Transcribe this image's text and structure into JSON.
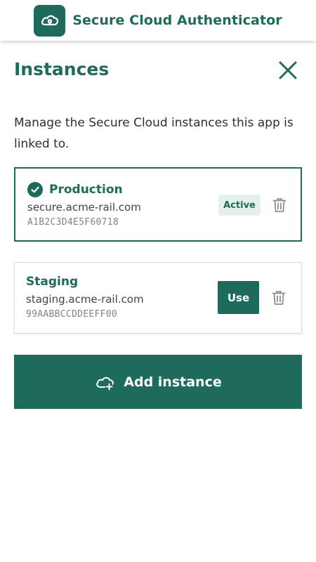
{
  "app": {
    "title": "Secure Cloud Authenticator",
    "logo_icon": "cloud-shield-icon"
  },
  "page": {
    "title": "Instances",
    "close_icon": "close-icon",
    "description": "Manage the Secure Cloud instances this app is linked to."
  },
  "instances": [
    {
      "name": "Production",
      "host": "secure.acme-rail.com",
      "fingerprint": "A1B2C3D4E5F60718",
      "status_label": "Active",
      "is_active": true
    },
    {
      "name": "Staging",
      "host": "staging.acme-rail.com",
      "fingerprint": "99AABBCCDDEEFF00",
      "action_label": "Use",
      "is_active": false
    }
  ],
  "add_instance": {
    "label": "Add instance",
    "icon": "cloud-add-icon"
  },
  "colors": {
    "brand": "#1e6b5b",
    "badge_bg": "#e4f0ec",
    "icon_gray": "#8a8f92"
  }
}
